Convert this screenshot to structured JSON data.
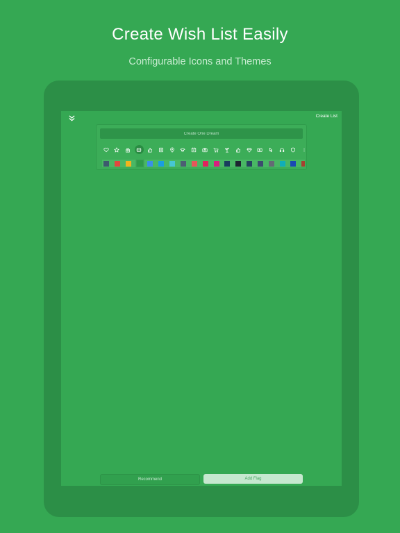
{
  "promo": {
    "title": "Create Wish List Easily",
    "subtitle": "Configurable Icons and Themes"
  },
  "app": {
    "top_bar": {
      "collapse_icon": "double-chevron-down-icon",
      "create_list_label": "Create List"
    },
    "form": {
      "name_placeholder": "Create One Dream",
      "icons": [
        "heart-icon",
        "star-icon",
        "gift-icon",
        "card-icon",
        "thumbs-up-icon",
        "list-icon",
        "location-icon",
        "graduation-icon",
        "calendar-icon",
        "camera-icon",
        "cart-icon",
        "plant-icon",
        "like-icon",
        "diamond-icon",
        "video-icon",
        "pointer-icon",
        "headphones-icon",
        "shield-icon",
        "more-icon"
      ],
      "selected_icon_index": 3,
      "colors": [
        "#3d5a6e",
        "#e0483e",
        "#f2b41c",
        "#2e9a4a",
        "#3a8fe8",
        "#1a9ee0",
        "#46c7d3",
        "#4c5e73",
        "#e4575a",
        "#e0225d",
        "#d71f7f",
        "#193d5e",
        "#1c2530",
        "#24445e",
        "#3c4c6e",
        "#646b74",
        "#10aeb8",
        "#1a49b3",
        "#a6412f"
      ],
      "selected_color_index": 3
    },
    "footer": {
      "recommend_label": "Recommend",
      "add_flag_label": "Add Flag"
    }
  }
}
